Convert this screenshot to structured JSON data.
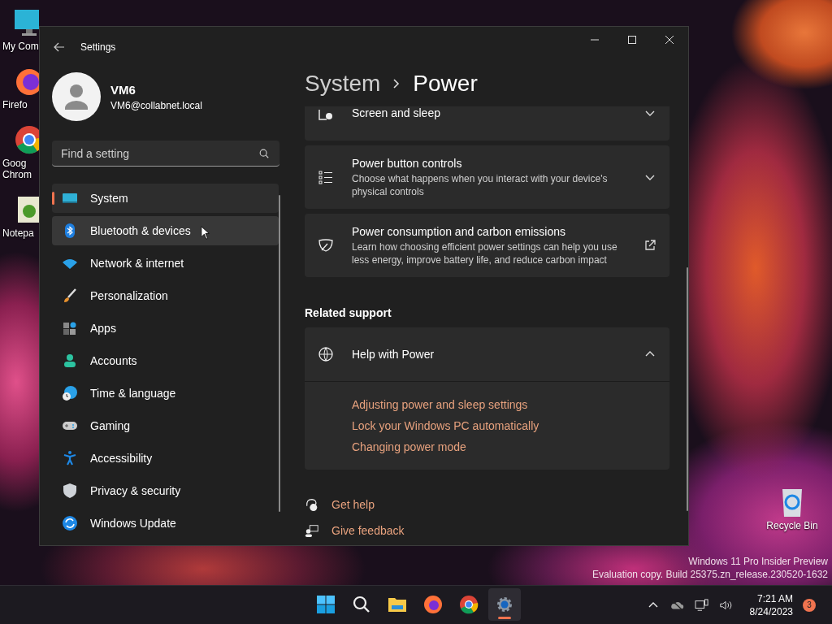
{
  "desktop": {
    "icons": [
      {
        "lines": [
          "My Com"
        ]
      },
      {
        "lines": [
          "Firefo"
        ]
      },
      {
        "lines": [
          "Goog",
          "Chrom"
        ]
      },
      {
        "lines": [
          "Notepa"
        ]
      }
    ],
    "recycle_bin": {
      "label": "Recycle Bin"
    },
    "watermark": [
      "Windows 11 Pro Insider Preview",
      "Evaluation copy. Build 25375.zn_release.230520-1632"
    ]
  },
  "window": {
    "title": "Settings",
    "profile": {
      "name": "VM6",
      "email": "VM6@collabnet.local"
    },
    "search": {
      "placeholder": "Find a setting"
    },
    "nav": [
      {
        "label": "System",
        "selected": true,
        "hovered": false
      },
      {
        "label": "Bluetooth & devices",
        "selected": false,
        "hovered": true
      },
      {
        "label": "Network & internet",
        "selected": false,
        "hovered": false
      },
      {
        "label": "Personalization",
        "selected": false,
        "hovered": false
      },
      {
        "label": "Apps",
        "selected": false,
        "hovered": false
      },
      {
        "label": "Accounts",
        "selected": false,
        "hovered": false
      },
      {
        "label": "Time & language",
        "selected": false,
        "hovered": false
      },
      {
        "label": "Gaming",
        "selected": false,
        "hovered": false
      },
      {
        "label": "Accessibility",
        "selected": false,
        "hovered": false
      },
      {
        "label": "Privacy & security",
        "selected": false,
        "hovered": false
      },
      {
        "label": "Windows Update",
        "selected": false,
        "hovered": false
      }
    ],
    "breadcrumb": [
      "System",
      "Power"
    ],
    "cards": [
      {
        "title": "Screen and sleep"
      },
      {
        "title": "Power button controls",
        "description": "Choose what happens when you interact with your device's physical controls"
      },
      {
        "title": "Power consumption and carbon emissions",
        "description": "Learn how choosing efficient power settings can help you use less energy, improve battery life, and reduce carbon impact"
      }
    ],
    "related_support": {
      "heading": "Related support",
      "title": "Help with Power",
      "expanded": true,
      "links": [
        "Adjusting power and sleep settings",
        "Lock your Windows PC automatically",
        "Changing power mode"
      ]
    },
    "footer_links": [
      "Get help",
      "Give feedback"
    ]
  },
  "taskbar": {
    "apps": [
      {
        "active": false
      },
      {
        "active": false
      },
      {
        "active": false
      },
      {
        "active": false
      },
      {
        "active": false
      },
      {
        "active": true
      }
    ],
    "clock": {
      "time": "7:21 AM",
      "date": "8/24/2023"
    },
    "notifications": "3"
  }
}
